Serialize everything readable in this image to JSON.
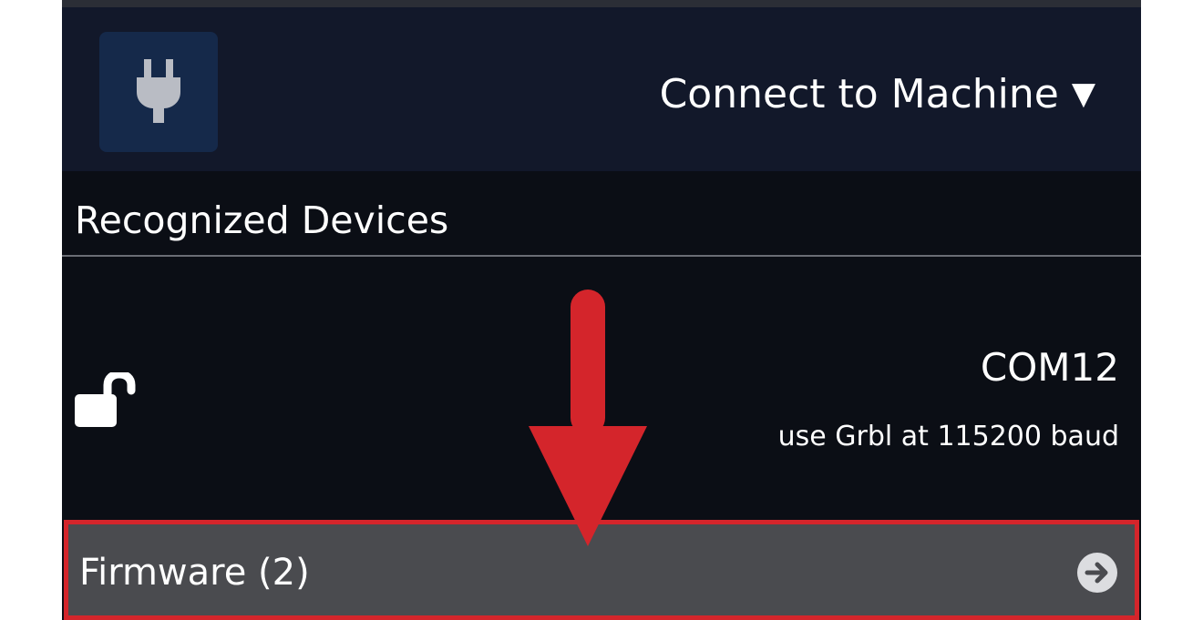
{
  "header": {
    "plug_icon": "plug-icon",
    "connect_label": "Connect to Machine",
    "caret": "▼"
  },
  "section": {
    "heading": "Recognized Devices"
  },
  "device": {
    "lock_icon": "unlock-icon",
    "port": "COM12",
    "description": "use Grbl at 115200 baud"
  },
  "firmware": {
    "label": "Firmware (2)",
    "arrow_icon": "arrow-right-circle-icon"
  },
  "annotation": {
    "arrow_icon": "red-down-arrow-icon",
    "highlight_color": "#d4252b"
  },
  "colors": {
    "panel_bg": "#0b0e15",
    "header_bg": "#12182a",
    "plug_box_bg": "#15294a",
    "firmware_bg": "#4a4b4f",
    "accent_red": "#d4252b"
  }
}
